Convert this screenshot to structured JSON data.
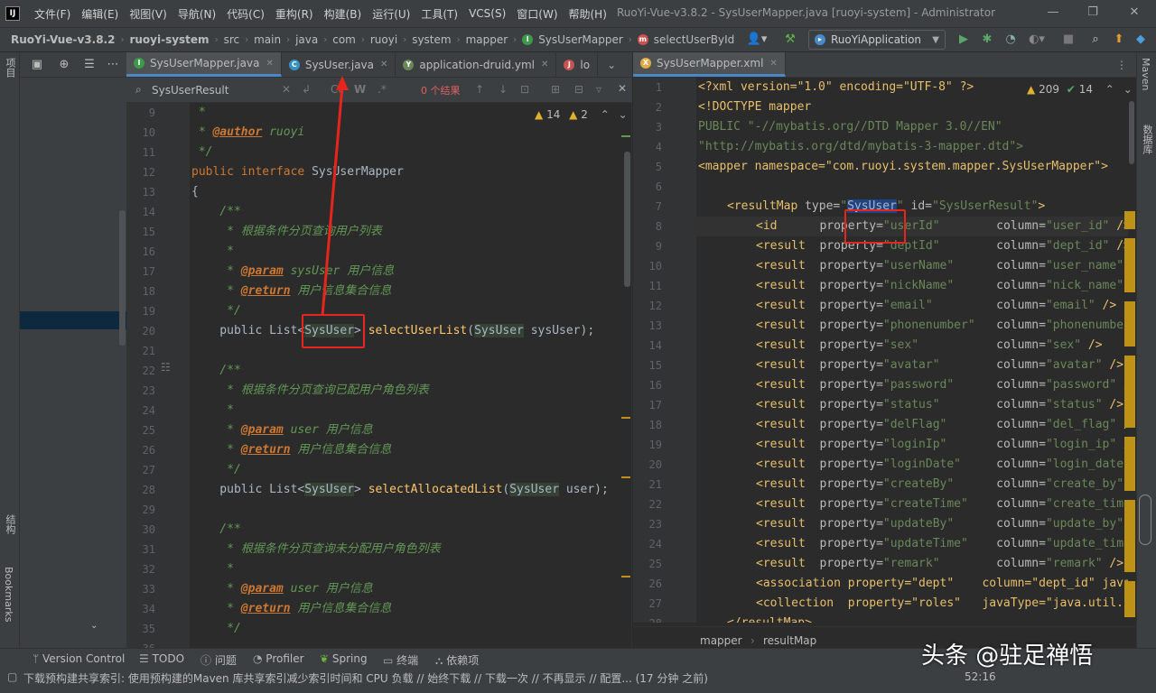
{
  "title_bar": {
    "app_logo": "IJ",
    "menus": [
      "文件(F)",
      "编辑(E)",
      "视图(V)",
      "导航(N)",
      "代码(C)",
      "重构(R)",
      "构建(B)",
      "运行(U)",
      "工具(T)",
      "VCS(S)",
      "窗口(W)",
      "帮助(H)"
    ],
    "window_title": "RuoYi-Vue-v3.8.2 - SysUserMapper.java [ruoyi-system] - Administrator"
  },
  "nav_bar": {
    "breadcrumbs": [
      "RuoYi-Vue-v3.8.2",
      "ruoyi-system",
      "src",
      "main",
      "java",
      "com",
      "ruoyi",
      "system",
      "mapper",
      "SysUserMapper",
      "selectUserById"
    ],
    "run_config": "RuoYiApplication"
  },
  "side_tabs": {
    "left": [
      "项目",
      "结构",
      "Bookmarks"
    ],
    "right": [
      "Maven",
      "数据库"
    ]
  },
  "left_editor": {
    "tabs": [
      {
        "label": "SysUserMapper.java",
        "icon": "I",
        "color": "#3d9a4b"
      },
      {
        "label": "SysUser.java",
        "icon": "C",
        "color": "#3592c4"
      },
      {
        "label": "application-druid.yml",
        "icon": "Y",
        "color": "#6a8759"
      },
      {
        "label": "lo",
        "icon": "J",
        "color": "#c75450"
      }
    ],
    "search": {
      "value": "SysUserResult",
      "result": "0 个结果"
    },
    "inspection": {
      "warnings": "14",
      "ok": "2"
    },
    "line_numbers": [
      "9",
      "10",
      "11",
      "12",
      "13",
      "14",
      "15",
      "16",
      "17",
      "18",
      "19",
      "20",
      "21",
      "22",
      "23",
      "24",
      "25",
      "26",
      "27",
      "28",
      "29",
      "30",
      "31",
      "32",
      "33",
      "34",
      "35",
      "36"
    ],
    "code": {
      "l9": " *",
      "l10_tag": "@author",
      "l10_val": " ruoyi",
      "l11": " */",
      "l12_kw1": "public",
      "l12_kw2": "interface",
      "l12_name": " SysUserMapper",
      "l13": "{",
      "l14": "    /**",
      "l15": "     * 根据条件分页查询用户列表",
      "l16": "     *",
      "l17_tag": "@param",
      "l17_rest": " sysUser 用户信息",
      "l18_tag": "@return",
      "l18_rest": " 用户信息集合信息",
      "l19": "     */",
      "l20_pre": "    public List<",
      "l20_type": "SysUser",
      "l20_mid": "> ",
      "l20_fn": "selectUserList",
      "l20_arg_type": "SysUser",
      "l20_end": " sysUser);",
      "l21": "",
      "l22": "    /**",
      "l23": "     * 根据条件分页查询已配用户角色列表",
      "l24": "     *",
      "l25_tag": "@param",
      "l25_rest": " user 用户信息",
      "l26_tag": "@return",
      "l26_rest": " 用户信息集合信息",
      "l27": "     */",
      "l28_pre": "    public List<",
      "l28_type": "SysUser",
      "l28_mid": "> ",
      "l28_fn": "selectAllocatedList",
      "l28_arg_type": "SysUser",
      "l28_end": " user);",
      "l29": "",
      "l30": "    /**",
      "l31": "     * 根据条件分页查询未分配用户角色列表",
      "l32": "     *",
      "l33_tag": "@param",
      "l33_rest": " user 用户信息",
      "l34_tag": "@return",
      "l34_rest": " 用户信息集合信息",
      "l35": "     */"
    }
  },
  "right_editor": {
    "tab": {
      "label": "SysUserMapper.xml",
      "icon": "X",
      "color": "#e0ab46"
    },
    "inspection": {
      "warnings": "209",
      "ok": "14"
    },
    "line_numbers": [
      "1",
      "2",
      "3",
      "4",
      "5",
      "6",
      "7",
      "8",
      "9",
      "10",
      "11",
      "12",
      "13",
      "14",
      "15",
      "16",
      "17",
      "18",
      "19",
      "20",
      "21",
      "22",
      "23",
      "24",
      "25",
      "26",
      "27",
      "28"
    ],
    "xml_header": [
      "<?xml version=\"1.0\" encoding=\"UTF-8\" ?>",
      "<!DOCTYPE mapper",
      "PUBLIC \"-//mybatis.org//DTD Mapper 3.0//EN\"",
      "\"http://mybatis.org/dtd/mybatis-3-mapper.dtd\">",
      "<mapper namespace=\"com.ruoyi.system.mapper.SysUserMapper\">"
    ],
    "result_map": {
      "type": "SysUser",
      "id": "SysUserResult"
    },
    "rows": [
      {
        "tag": "id",
        "prop": "userId",
        "col": "user_id"
      },
      {
        "tag": "result",
        "prop": "deptId",
        "col": "dept_id"
      },
      {
        "tag": "result",
        "prop": "userName",
        "col": "user_name"
      },
      {
        "tag": "result",
        "prop": "nickName",
        "col": "nick_name"
      },
      {
        "tag": "result",
        "prop": "email",
        "col": "email"
      },
      {
        "tag": "result",
        "prop": "phonenumber",
        "col": "phonenumber"
      },
      {
        "tag": "result",
        "prop": "sex",
        "col": "sex"
      },
      {
        "tag": "result",
        "prop": "avatar",
        "col": "avatar"
      },
      {
        "tag": "result",
        "prop": "password",
        "col": "password"
      },
      {
        "tag": "result",
        "prop": "status",
        "col": "status"
      },
      {
        "tag": "result",
        "prop": "delFlag",
        "col": "del_flag"
      },
      {
        "tag": "result",
        "prop": "loginIp",
        "col": "login_ip"
      },
      {
        "tag": "result",
        "prop": "loginDate",
        "col": "login_date"
      },
      {
        "tag": "result",
        "prop": "createBy",
        "col": "create_by"
      },
      {
        "tag": "result",
        "prop": "createTime",
        "col": "create_time"
      },
      {
        "tag": "result",
        "prop": "updateBy",
        "col": "update_by"
      },
      {
        "tag": "result",
        "prop": "updateTime",
        "col": "update_time"
      },
      {
        "tag": "result",
        "prop": "remark",
        "col": "remark"
      }
    ],
    "association_line": "<association property=\"dept\"    column=\"dept_id\" java",
    "collection_line": "<collection  property=\"roles\"   javaType=\"java.util.",
    "close_line": "</resultMap>",
    "breadcrumb": [
      "mapper",
      "resultMap"
    ]
  },
  "status_bar": {
    "tabs": [
      "Version Control",
      "TODO",
      "问题",
      "Profiler",
      "Spring",
      "终端",
      "依赖项"
    ],
    "message": "下载预构建共享索引: 使用预构建的Maven 库共享索引减少索引时间和 CPU 负载 // 始终下载 // 下载一次 // 不再显示 // 配置... (17 分钟 之前)",
    "position": "52:16"
  },
  "watermark": "头条 @驻足禅悟"
}
